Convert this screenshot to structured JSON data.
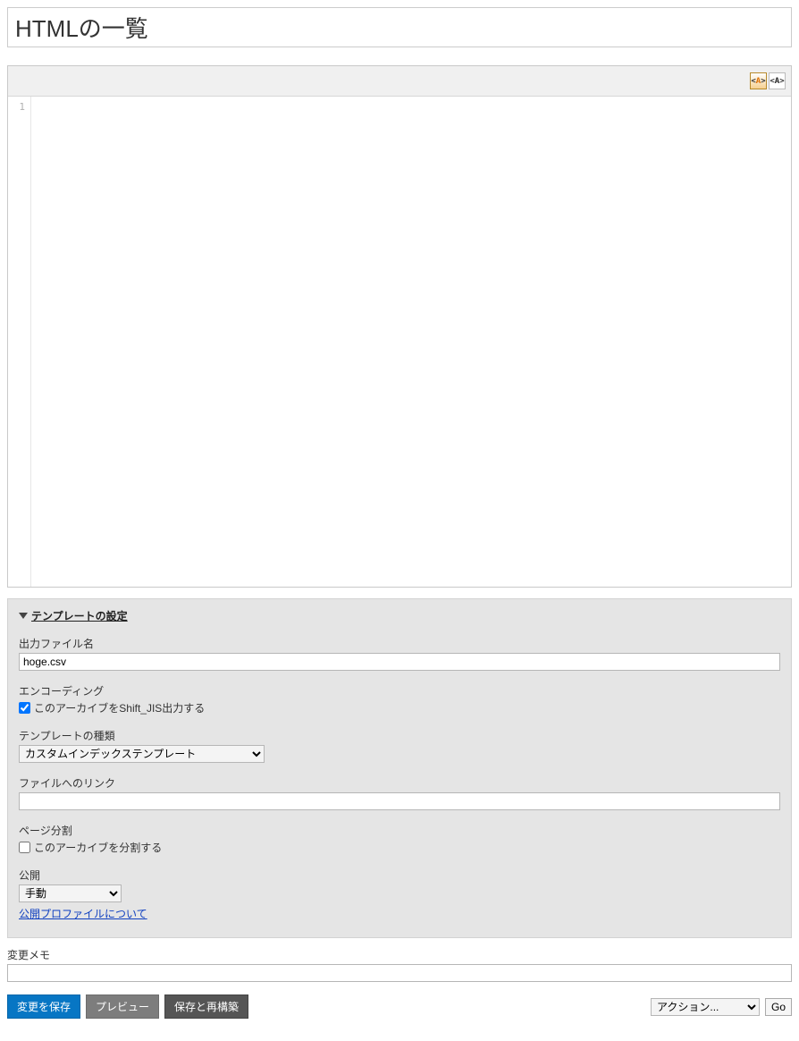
{
  "title": "HTMLの一覧",
  "editor": {
    "gutter_first_line": "1",
    "content": ""
  },
  "settings": {
    "section_title": "テンプレートの設定",
    "output_filename": {
      "label": "出力ファイル名",
      "value": "hoge.csv"
    },
    "encoding": {
      "label": "エンコーディング",
      "checked": true,
      "checkbox_label": "このアーカイブをShift_JIS出力する"
    },
    "template_type": {
      "label": "テンプレートの種類",
      "selected": "カスタムインデックステンプレート"
    },
    "file_link": {
      "label": "ファイルへのリンク",
      "value": ""
    },
    "pagination": {
      "label": "ページ分割",
      "checked": false,
      "checkbox_label": "このアーカイブを分割する"
    },
    "publish": {
      "label": "公開",
      "selected": "手動",
      "help_link": "公開プロファイルについて"
    }
  },
  "memo": {
    "label": "変更メモ",
    "value": ""
  },
  "buttons": {
    "save": "変更を保存",
    "preview": "プレビュー",
    "rebuild": "保存と再構築",
    "action_select": "アクション...",
    "go": "Go"
  }
}
